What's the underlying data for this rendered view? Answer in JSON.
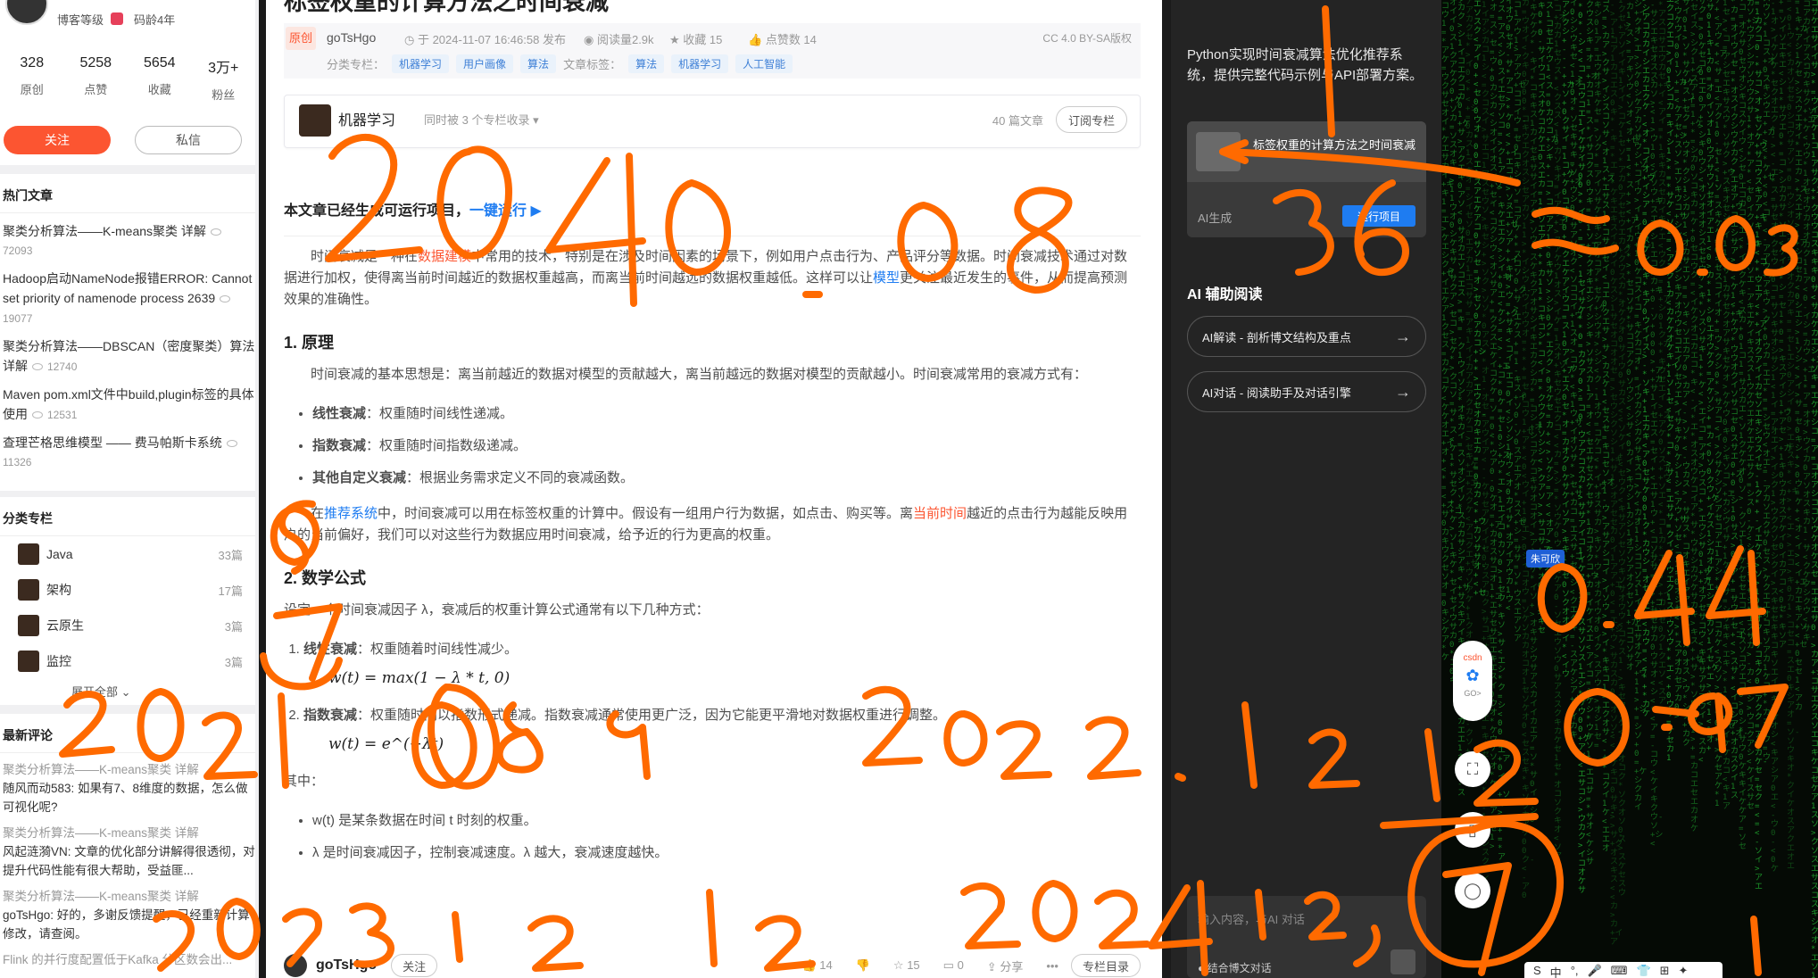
{
  "profile": {
    "level_label": "博客等级",
    "age_label": "码龄4年",
    "stats": [
      {
        "num": "328",
        "label": "原创"
      },
      {
        "num": "5258",
        "label": "点赞"
      },
      {
        "num": "5654",
        "label": "收藏"
      },
      {
        "num": "3万+",
        "label": "粉丝"
      }
    ],
    "follow": "关注",
    "message": "私信"
  },
  "hot": {
    "title": "热门文章",
    "items": [
      {
        "title": "聚类分析算法——K-means聚类 详解",
        "views": "72093"
      },
      {
        "title": "Hadoop启动NameNode报错ERROR: Cannot set priority of namenode process 2639",
        "views": "19077"
      },
      {
        "title": "聚类分析算法——DBSCAN（密度聚类）算法详解",
        "views": "12740"
      },
      {
        "title": "Maven pom.xml文件中build,plugin标签的具体使用",
        "views": "12531"
      },
      {
        "title": "查理芒格思维模型 —— 费马帕斯卡系统",
        "views": "11326"
      }
    ]
  },
  "columns": {
    "title": "分类专栏",
    "items": [
      {
        "name": "Java",
        "count": "33篇"
      },
      {
        "name": "架构",
        "count": "17篇"
      },
      {
        "name": "云原生",
        "count": "3篇"
      },
      {
        "name": "监控",
        "count": "3篇"
      }
    ],
    "expand": "展开全部"
  },
  "comments": {
    "title": "最新评论",
    "items": [
      {
        "article": "聚类分析算法——K-means聚类 详解",
        "text": "随风而动583: 如果有7、8维度的数据，怎么做可视化呢?"
      },
      {
        "article": "聚类分析算法——K-means聚类 详解",
        "text": "风起涟漪VN: 文章的优化部分讲解得很透彻，对提升代码性能有很大帮助，受益匪..."
      },
      {
        "article": "聚类分析算法——K-means聚类 详解",
        "text": "goTsHgo: 好的，多谢反馈提醒，已经重新计算修改，请查阅。"
      },
      {
        "article": "Flink 的并行度配置低于Kafka 分区数会出...",
        "text": ""
      }
    ]
  },
  "article": {
    "title": "标签权重的计算方法之时间衰减",
    "original": "原创",
    "author": "goTsHgo",
    "published": "于 2024-11-07 16:46:58 发布",
    "reads": "阅读量2.9k",
    "favs": "收藏 15",
    "likes": "点赞数 14",
    "license": "CC 4.0 BY-SA版权",
    "cat_label": "分类专栏：",
    "cats": [
      "机器学习",
      "用户画像",
      "算法"
    ],
    "tag_label": "文章标签：",
    "tags": [
      "算法",
      "机器学习",
      "人工智能"
    ],
    "column_name": "机器学习",
    "column_sub": "同时被 3 个专栏收录",
    "column_count": "40 篇文章",
    "column_subscribe": "订阅专栏",
    "run_text": "本文章已经生成可运行项目，",
    "run_link": "一键运行 ▶",
    "intro_a": "时间衰减是一种在",
    "intro_kw1": "数据建模",
    "intro_b": "中常用的技术，特别是在涉及时间因素的场景下，例如用户点击行为、产品评分等数据。时间衰减技术通过对数据进行加权，使得离当前时间越近的数据权重越高，而离当前时间越远的数据权重越低。这样可以让",
    "intro_link": "模型",
    "intro_c": "更关注最近发生的事件，从而提高预测效果的准确性。",
    "h1": "1. 原理",
    "p1": "时间衰减的基本思想是：离当前越近的数据对模型的贡献越大，离当前越远的数据对模型的贡献越小。时间衰减常用的衰减方式有：",
    "list1": [
      {
        "b": "线性衰减",
        "t": "：权重随时间线性递减。"
      },
      {
        "b": "指数衰减",
        "t": "：权重随时间指数级递减。"
      },
      {
        "b": "其他自定义衰减",
        "t": "：根据业务需求定义不同的衰减函数。"
      }
    ],
    "p2_a": "在",
    "p2_link": "推荐系统",
    "p2_b": "中，时间衰减可以用在标签权重的计算中。假设有一组用户行为数据，如点击、购买等。离",
    "p2_kw": "当前时间",
    "p2_c": "越近的点击行为越能反映用户的当前偏好，我们可以对这些行为数据应用时间衰减，给予近的行为更高的权重。",
    "h2": "2. 数学公式",
    "p3": "设定一个时间衰减因子 λ，衰减后的权重计算公式通常有以下几种方式：",
    "ol": [
      {
        "b": "线性衰减",
        "t": "：权重随着时间线性减少。",
        "f": "w(t) = max(1 − λ * t, 0)"
      },
      {
        "b": "指数衰减",
        "t": "：权重随时间以指数形式递减。指数衰减通常使用更广泛，因为它能更平滑地对数据权重进行调整。",
        "f": "w(t) = e^(−λt)"
      }
    ],
    "where": "其中：",
    "list2": [
      "w(t) 是某条数据在时间 t 时刻的权重。",
      "λ 是时间衰减因子，控制衰减速度。λ 越大，衰减速度越快。"
    ],
    "bottom": {
      "author": "goTsHgo",
      "follow": "关注",
      "likes": "14",
      "favs": "15",
      "comments": "0",
      "share": "分享",
      "more": "•••",
      "dir": "专栏目录"
    }
  },
  "ai": {
    "desc": "Python实现时间衰减算法优化推荐系统，提供完整代码示例与API部署方案。",
    "proj_title": "标签权重的计算方法之时间衰减",
    "proj_gen": "AI生成",
    "proj_run": "运行项目",
    "read_title": "AI 辅助阅读",
    "btn1": "AI解读 - 剖析博文结构及重点",
    "btn2": "AI对话 - 阅读助手及对话引擎",
    "input_ph": "输入内容，与AI 对话",
    "input_foot": "结合博文对话"
  },
  "float": {
    "not_visible": "朱可欣",
    "csdn": "csdn",
    "go": "GO>"
  },
  "ime": [
    "S",
    "中",
    "°,",
    "🎤",
    "⌨",
    "👕",
    "⊞",
    "✦"
  ],
  "colors": {
    "accent": "#fc5531",
    "link": "#1e7cf1",
    "scribble": "#ff6a00",
    "matrix": "#1fa32e"
  }
}
